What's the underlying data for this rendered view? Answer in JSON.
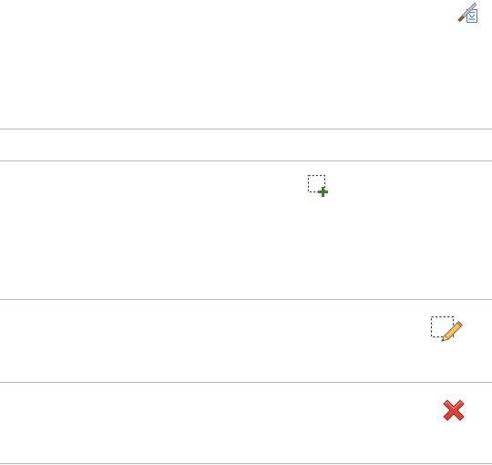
{
  "toolbar": {
    "properties_icon": "document-properties-icon"
  },
  "regions": {
    "add_icon": "add-selection-icon",
    "edit_icon": "edit-selection-icon",
    "delete_icon": "delete-icon"
  },
  "colors": {
    "divider": "#b9b9b9",
    "add_green": "#2e8b1f",
    "delete_red": "#d9433b",
    "pencil_orange": "#e8a43a"
  }
}
